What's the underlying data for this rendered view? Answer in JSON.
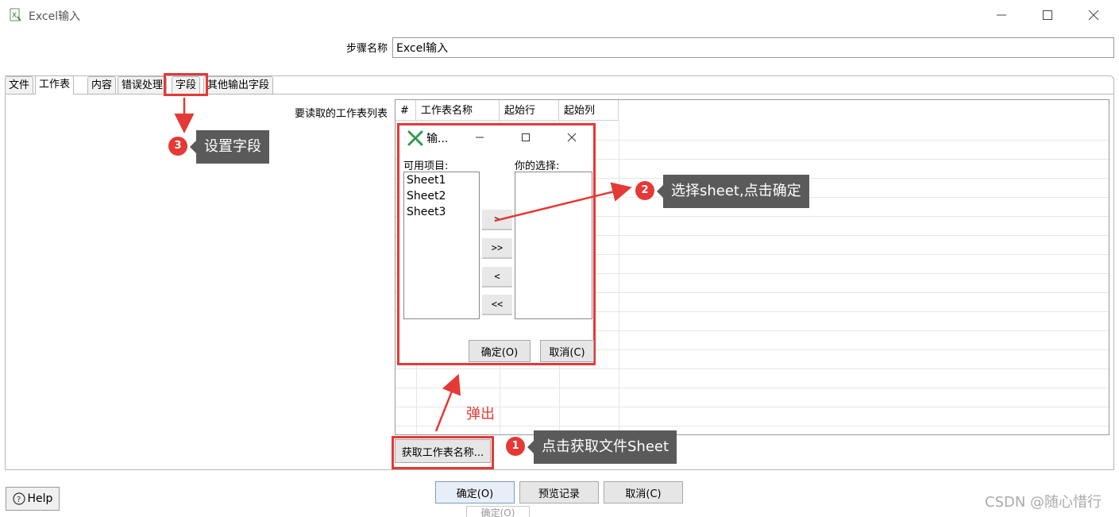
{
  "window": {
    "title": "Excel输入",
    "controls": [
      "minimize-icon",
      "maximize-icon",
      "close-icon"
    ]
  },
  "step": {
    "label": "步骤名称",
    "value": "Excel输入"
  },
  "tabs": [
    {
      "label": "文件"
    },
    {
      "label": "工作表",
      "active": true
    },
    {
      "label": "内容"
    },
    {
      "label": "错误处理"
    },
    {
      "label": "字段"
    },
    {
      "label": "其他输出字段"
    }
  ],
  "sheet_table": {
    "label": "要读取的工作表列表",
    "columns": [
      "#",
      "工作表名称",
      "起始行",
      "起始列"
    ]
  },
  "get_sheets_button": "获取工作表名称...",
  "dialog": {
    "title": "输...",
    "available_label": "可用项目:",
    "available_items": [
      "Sheet1",
      "Sheet2",
      "Sheet3"
    ],
    "selected_label": "你的选择:",
    "selected_items": [],
    "move_buttons": [
      ">",
      ">>",
      "<",
      "<<"
    ],
    "ok": "确定(O)",
    "cancel": "取消(C)"
  },
  "bottom": {
    "help": "Help",
    "ok": "确定(O)",
    "preview": "预览记录",
    "cancel": "取消(C)",
    "ok_ghost": "确定(O)"
  },
  "annotations": {
    "step1": {
      "number": "1",
      "text": "点击获取文件Sheet"
    },
    "step2": {
      "number": "2",
      "text": "选择sheet,点击确定"
    },
    "step3": {
      "number": "3",
      "text": "设置字段"
    },
    "popup": "弹出",
    "accent_color": "#e53935"
  },
  "watermark": "CSDN @随心惜行"
}
